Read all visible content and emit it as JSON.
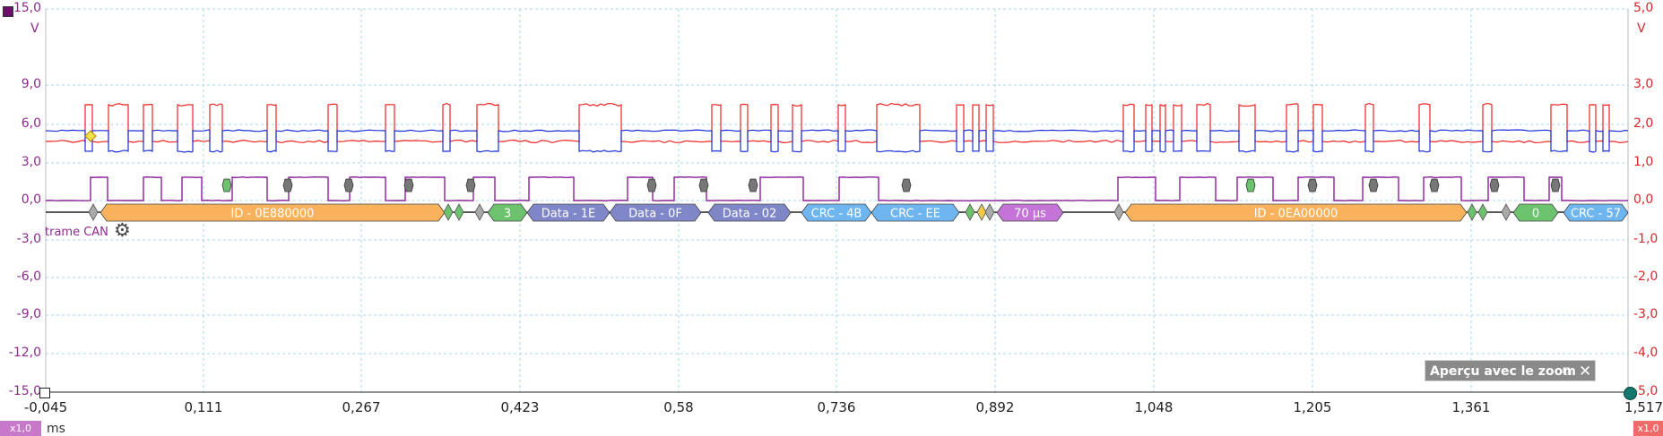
{
  "colors": {
    "left_axis": "#8e2a8e",
    "right_axis": "#d8262a",
    "red_channel": "#ee2222",
    "blue_channel": "#1a2fd8",
    "purple_channel": "#8a1e9a",
    "grid": "#a9d6ea",
    "frame_id": "#f9b25c",
    "frame_len": "#6dc26d",
    "frame_data": "#7f87c9",
    "frame_crc": "#6fb6f0",
    "frame_time": "#c374d6",
    "badge_bg": "#c878c8"
  },
  "left_axis": {
    "unit": "V",
    "ticks": [
      "15,0",
      "9,0",
      "6,0",
      "3,0",
      "0,0",
      "-3,0",
      "-6,0",
      "-9,0",
      "-12,0",
      "-15,0"
    ]
  },
  "right_axis": {
    "unit": "V",
    "ticks": [
      "5,0",
      "3,0",
      "2,0",
      "1,0",
      "0,0",
      "-1,0",
      "-2,0",
      "-3,0",
      "-4,0",
      "-5,0"
    ]
  },
  "x_axis": {
    "unit": "ms",
    "ticks": [
      "-0,045",
      "0,111",
      "0,267",
      "0,423",
      "0,58",
      "0,736",
      "0,892",
      "1,048",
      "1,205",
      "1,361",
      "1,517"
    ]
  },
  "decoder": {
    "label": "trame CAN",
    "settings_icon": "gear-icon",
    "frames": [
      {
        "kind": "id",
        "label": "ID - 0E880000"
      },
      {
        "kind": "len",
        "label": "3"
      },
      {
        "kind": "data",
        "label": "Data - 1E"
      },
      {
        "kind": "data",
        "label": "Data - 0F"
      },
      {
        "kind": "data",
        "label": "Data - 02"
      },
      {
        "kind": "crc",
        "label": "CRC - 4B"
      },
      {
        "kind": "crc",
        "label": "CRC - EE"
      },
      {
        "kind": "time",
        "label": "70 µs"
      },
      {
        "kind": "id",
        "label": "ID - 0EA00000"
      },
      {
        "kind": "len",
        "label": "0"
      },
      {
        "kind": "crc",
        "label": "CRC - 57"
      }
    ]
  },
  "zoom_panel": {
    "title": "Aperçu avec le zoom",
    "restore_icon": "restore-icon",
    "close_icon": "close-icon"
  },
  "badges": {
    "left_scale": "x1,0",
    "right_scale": "x1,0"
  }
}
